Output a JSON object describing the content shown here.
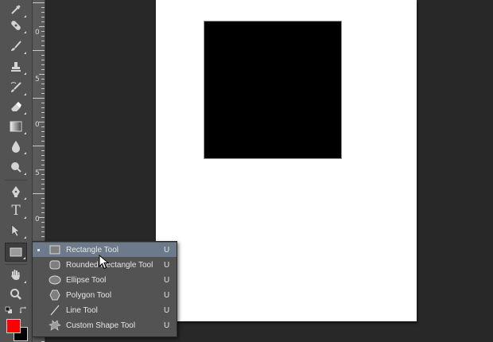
{
  "ruler": {
    "labels": [
      "0",
      "5",
      "0",
      "5",
      "0"
    ]
  },
  "toolbar": {
    "tools": [
      {
        "icon": "eyedropper-icon"
      },
      {
        "icon": "healing-brush-icon"
      },
      {
        "icon": "brush-icon"
      },
      {
        "icon": "clone-stamp-icon"
      },
      {
        "icon": "history-brush-icon"
      },
      {
        "icon": "eraser-icon"
      },
      {
        "icon": "gradient-icon"
      },
      {
        "icon": "blur-icon"
      },
      {
        "icon": "dodge-icon"
      },
      {
        "icon": "pen-icon"
      },
      {
        "icon": "type-icon"
      },
      {
        "icon": "path-selection-icon"
      },
      {
        "icon": "rectangle-shape-icon"
      },
      {
        "icon": "hand-icon"
      },
      {
        "icon": "zoom-icon"
      }
    ],
    "type_tool_glyph": "T",
    "foreground_color": "#ff0000",
    "background_color": "#000000"
  },
  "shape_menu": {
    "items": [
      {
        "label": "Rectangle Tool",
        "shortcut": "U",
        "icon": "rectangle-icon",
        "selected": true
      },
      {
        "label": "Rounded Rectangle Tool",
        "shortcut": "U",
        "icon": "rounded-rectangle-icon",
        "selected": false
      },
      {
        "label": "Ellipse Tool",
        "shortcut": "U",
        "icon": "ellipse-icon",
        "selected": false
      },
      {
        "label": "Polygon Tool",
        "shortcut": "U",
        "icon": "polygon-icon",
        "selected": false
      },
      {
        "label": "Line Tool",
        "shortcut": "U",
        "icon": "line-icon",
        "selected": false
      },
      {
        "label": "Custom Shape Tool",
        "shortcut": "U",
        "icon": "custom-shape-icon",
        "selected": false
      }
    ]
  },
  "colors": {
    "workspace": "#282828",
    "panel": "#535353",
    "menu_highlight": "#6d7a8c",
    "document": "#ffffff",
    "shape_fill": "#000000"
  }
}
